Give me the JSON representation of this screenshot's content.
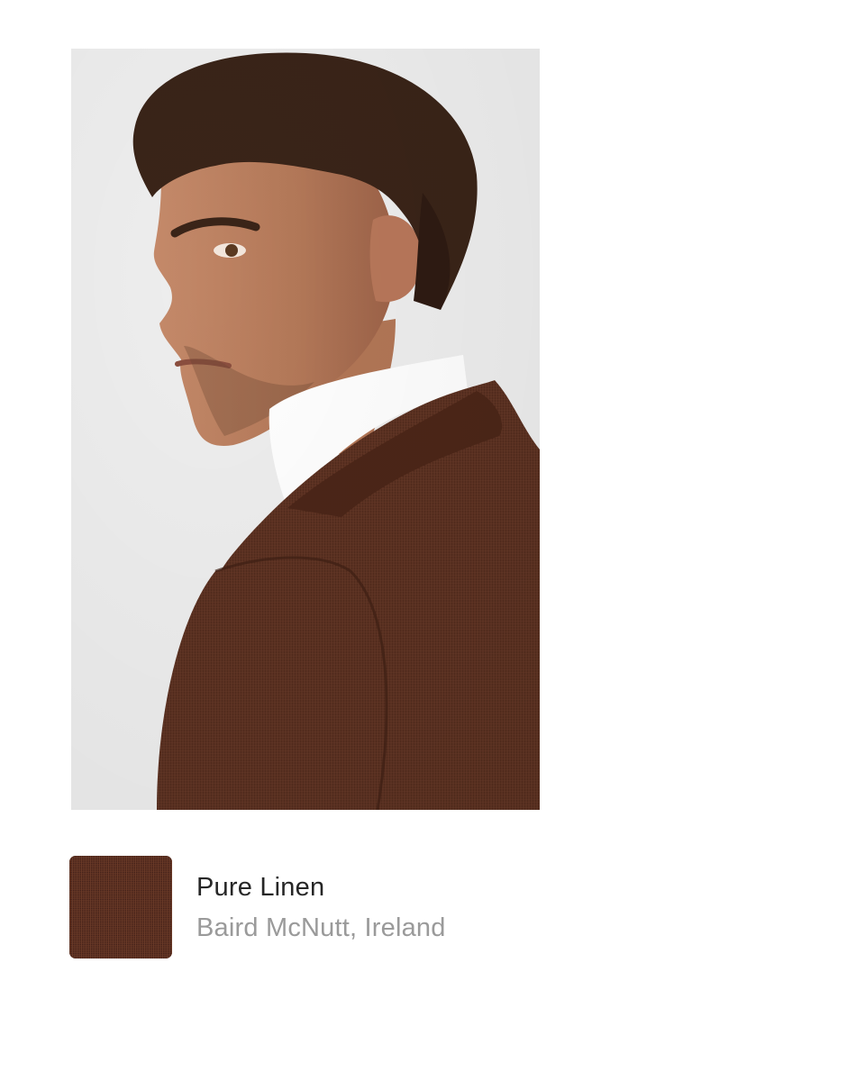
{
  "product": {
    "image_icon": "model-portrait-image",
    "fabric_name": "Pure Linen",
    "fabric_mill": "Baird McNutt, Ireland",
    "swatch_icon": "fabric-swatch-image"
  },
  "colors": {
    "background": "#ffffff",
    "image_backdrop": "#eeeeee",
    "jacket_brown": "#5a3020",
    "title_text": "#262626",
    "subtitle_text": "#9a9a9a"
  }
}
